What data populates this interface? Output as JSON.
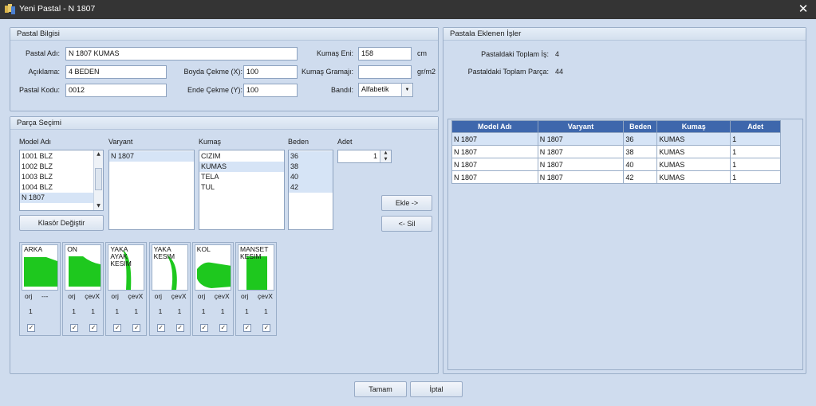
{
  "window": {
    "title": "Yeni Pastal - N 1807",
    "close_glyph": "✕"
  },
  "pastal_bilgisi": {
    "header": "Pastal Bilgisi",
    "pastal_adi": {
      "label": "Pastal Adı:",
      "value": "N 1807 KUMAS"
    },
    "aciklama": {
      "label": "Açıklama:",
      "value": "4 BEDEN"
    },
    "pastal_kodu": {
      "label": "Pastal Kodu:",
      "value": "0012"
    },
    "boyda_cekme": {
      "label": "Boyda Çekme (X):",
      "value": "100"
    },
    "ende_cekme": {
      "label": "Ende Çekme (Y):",
      "value": "100"
    },
    "kumas_eni": {
      "label": "Kumaş Eni:",
      "value": "158",
      "unit": "cm"
    },
    "kumas_gramaji": {
      "label": "Kumaş Gramajı:",
      "value": "",
      "unit": "gr/m2"
    },
    "bandil": {
      "label": "Bandıl:",
      "value": "Alfabetik"
    }
  },
  "parca_secimi": {
    "header": "Parça Seçimi",
    "model_adi": {
      "label": "Model Adı",
      "items": [
        "1001 BLZ",
        "1002 BLZ",
        "1003 BLZ",
        "1004 BLZ",
        "N 1807"
      ],
      "selected_index": 4
    },
    "varyant": {
      "label": "Varyant",
      "items": [
        "N 1807"
      ],
      "selected_index": 0
    },
    "kumas": {
      "label": "Kumaş",
      "items": [
        "CIZIM",
        "KUMAS",
        "TELA",
        "TUL"
      ],
      "selected_index": 1
    },
    "beden": {
      "label": "Beden",
      "items": [
        "36",
        "38",
        "40",
        "42"
      ]
    },
    "adet": {
      "label": "Adet",
      "value": "1"
    },
    "klasor_button": "Klasör Değiştir",
    "ekle_button": "Ekle ->",
    "sil_button": "<- Sil",
    "pieces": [
      {
        "name": "ARKA",
        "cap1": "orj",
        "cap2": "---",
        "num1": "1",
        "num2": "",
        "chk1": true,
        "chk2": false
      },
      {
        "name": "ON",
        "cap1": "orj",
        "cap2": "çevX",
        "num1": "1",
        "num2": "1",
        "chk1": true,
        "chk2": true
      },
      {
        "name": "YAKA AYAK KESIM",
        "cap1": "orj",
        "cap2": "çevX",
        "num1": "1",
        "num2": "1",
        "chk1": true,
        "chk2": true
      },
      {
        "name": "YAKA KESIM",
        "cap1": "orj",
        "cap2": "çevX",
        "num1": "1",
        "num2": "1",
        "chk1": true,
        "chk2": true
      },
      {
        "name": "KOL",
        "cap1": "orj",
        "cap2": "çevX",
        "num1": "1",
        "num2": "1",
        "chk1": true,
        "chk2": true
      },
      {
        "name": "MANSET KESIM",
        "cap1": "orj",
        "cap2": "çevX",
        "num1": "1",
        "num2": "1",
        "chk1": true,
        "chk2": true
      }
    ],
    "piece_fill_color": "#1ec81e",
    "check_glyph": "✓"
  },
  "pastala_eklenen": {
    "header": "Pastala Eklenen İşler",
    "toplam_is": {
      "label": "Pastaldaki Toplam İş:",
      "value": "4"
    },
    "toplam_parca": {
      "label": "Pastaldaki Toplam Parça:",
      "value": "44"
    },
    "table": {
      "columns": [
        "Model Adı",
        "Varyant",
        "Beden",
        "Kumaş",
        "Adet"
      ],
      "rows": [
        [
          "N 1807",
          "N 1807",
          "36",
          "KUMAS",
          "1"
        ],
        [
          "N 1807",
          "N 1807",
          "38",
          "KUMAS",
          "1"
        ],
        [
          "N 1807",
          "N 1807",
          "40",
          "KUMAS",
          "1"
        ],
        [
          "N 1807",
          "N 1807",
          "42",
          "KUMAS",
          "1"
        ]
      ],
      "selected_row": 0
    }
  },
  "footer": {
    "tamam": "Tamam",
    "iptal": "İptal"
  },
  "colors": {
    "title_bar": "#343434",
    "grid_header": "#3e67ac",
    "selection": "#d6e4f6"
  }
}
